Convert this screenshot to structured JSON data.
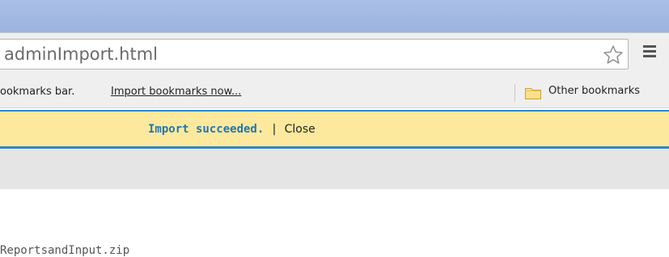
{
  "browser": {
    "address_bar": {
      "url_text": "adminImport.html"
    },
    "icons": {
      "star": "star-outline-icon",
      "menu": "hamburger-menu-icon",
      "folder": "folder-icon"
    }
  },
  "bookmarks_bar": {
    "prompt_text": "ookmarks bar.",
    "import_link": "Import bookmarks now...",
    "other_bookmarks": "Other bookmarks"
  },
  "infobar": {
    "message": "Import succeeded.",
    "separator": "|",
    "close_label": "Close",
    "colors": {
      "background": "#fce99d",
      "border": "#2f86c4",
      "message": "#1f77b4"
    }
  },
  "page": {
    "file_name": "ReportsandInput.zip"
  }
}
